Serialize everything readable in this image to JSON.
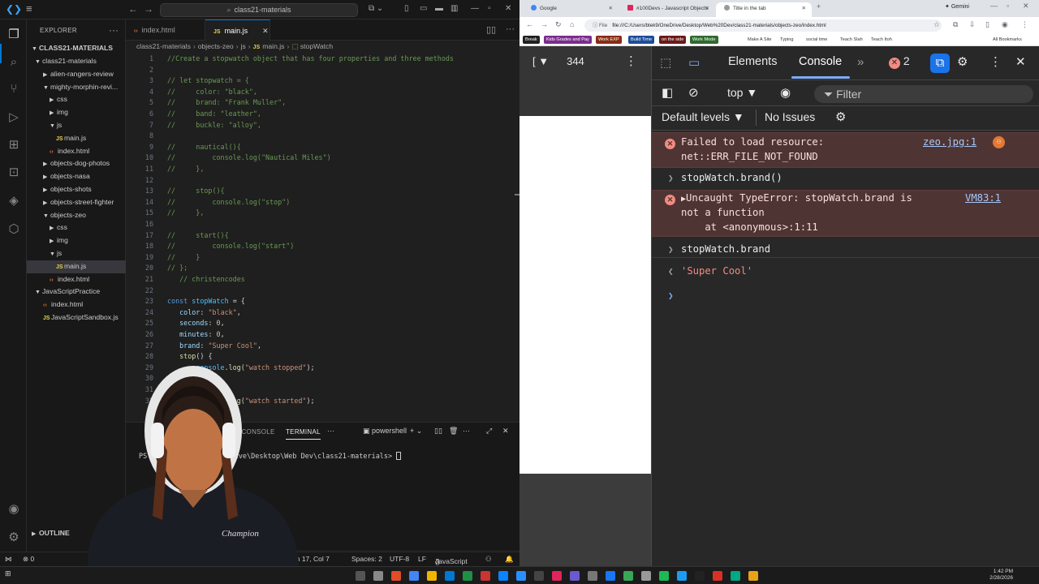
{
  "vscode": {
    "search_text": "class21-materials",
    "explorer_title": "EXPLORER",
    "project_root": "CLASS21-MATERIALS",
    "tree": [
      {
        "label": "class21-materials",
        "type": "folder-open",
        "depth": 1
      },
      {
        "label": "alien-rangers-review",
        "type": "folder",
        "depth": 2
      },
      {
        "label": "mighty-morphin-revi...",
        "type": "folder-open",
        "depth": 2
      },
      {
        "label": "css",
        "type": "folder",
        "depth": 3
      },
      {
        "label": "img",
        "type": "folder",
        "depth": 3
      },
      {
        "label": "js",
        "type": "folder-open",
        "depth": 3
      },
      {
        "label": "main.js",
        "type": "js",
        "depth": 4
      },
      {
        "label": "index.html",
        "type": "html",
        "depth": 3
      },
      {
        "label": "objects-dog-photos",
        "type": "folder",
        "depth": 2
      },
      {
        "label": "objects-nasa",
        "type": "folder",
        "depth": 2
      },
      {
        "label": "objects-shots",
        "type": "folder",
        "depth": 2
      },
      {
        "label": "objects-street-fighter",
        "type": "folder",
        "depth": 2
      },
      {
        "label": "objects-zeo",
        "type": "folder-open",
        "depth": 2
      },
      {
        "label": "css",
        "type": "folder",
        "depth": 3
      },
      {
        "label": "img",
        "type": "folder",
        "depth": 3
      },
      {
        "label": "js",
        "type": "folder-open",
        "depth": 3
      },
      {
        "label": "main.js",
        "type": "js",
        "depth": 4,
        "selected": true
      },
      {
        "label": "index.html",
        "type": "html",
        "depth": 3
      },
      {
        "label": "JavaScriptPractice",
        "type": "folder-open",
        "depth": 1
      },
      {
        "label": "index.html",
        "type": "html",
        "depth": 2
      },
      {
        "label": "JavaScriptSandbox.js",
        "type": "js",
        "depth": 2
      }
    ],
    "tabs": [
      {
        "label": "index.html",
        "type": "html"
      },
      {
        "label": "main.js",
        "type": "js",
        "active": true
      }
    ],
    "breadcrumbs": [
      "class21-materials",
      "objects-zeo",
      "js",
      "main.js",
      "stopWatch"
    ],
    "code_lines": [
      "//Create a stopwatch object that has four properties and three methods",
      "",
      "// let stopwatch = {",
      "//     color: \"black\",",
      "//     brand: \"Frank Muller\",",
      "//     band: \"leather\",",
      "//     buckle: \"alloy\",",
      "",
      "//     nautical(){",
      "//         console.log(\"Nautical Miles\")",
      "//     },",
      "",
      "//     stop(){",
      "//         console.log(\"stop\")",
      "//     },",
      "",
      "//     start(){",
      "//         console.log(\"start\")",
      "//     }",
      "// };",
      "   // christencodes",
      "",
      "const stopWatch = {",
      "   color: \"black\",",
      "   seconds: 0,",
      "   minutes: 0,",
      "   brand: \"Super Cool\",",
      "   stop() {",
      "       console.log(\"watch stopped\");",
      "   },",
      "   start() {",
      "       console.log(\"watch started\");"
    ],
    "panel_tabs": [
      "DEBUG CONSOLE",
      "TERMINAL"
    ],
    "terminal_shell": "powershell",
    "terminal_prompt": "PS C:\\Users\\btek9\\OneDrive\\Desktop\\Web Dev\\class21-materials> ",
    "status": {
      "position": "Ln 17, Col 7",
      "spaces": "Spaces: 2",
      "encoding": "UTF-8",
      "eol": "LF",
      "language": "JavaScript",
      "outline": "OUTLINE"
    }
  },
  "browser": {
    "tabs": [
      {
        "label": "Google",
        "color": "#4285f4"
      },
      {
        "label": "#100Devs - Javascript Objects",
        "color": "#e0245e"
      },
      {
        "label": "Title in the tab",
        "color": "#888",
        "active": true
      }
    ],
    "profile": "Gemini",
    "address_scheme": "File",
    "address": "file:///C:/Users/btek9/OneDrive/Desktop/Web%20Dev/class21-materials/objects-zeo/index.html",
    "bookmarks": [
      {
        "label": "Break",
        "bg": "#222",
        "fg": "#fff"
      },
      {
        "label": "Kids Grades and Pay",
        "bg": "#7b2d8e",
        "fg": "#fff"
      },
      {
        "label": "Work EXP",
        "bg": "#8a2c14",
        "fg": "#fff"
      },
      {
        "label": "Build Time",
        "bg": "#1c4d9a",
        "fg": "#fff"
      },
      {
        "label": "on the side",
        "bg": "#6a1a1a",
        "fg": "#fff"
      },
      {
        "label": "Work Mode",
        "bg": "#2e6b2e",
        "fg": "#fff"
      },
      {
        "label": "Make A Site",
        "bg": "transparent",
        "fg": "#333"
      },
      {
        "label": "Typing",
        "bg": "transparent",
        "fg": "#333"
      },
      {
        "label": "social time",
        "bg": "transparent",
        "fg": "#333"
      },
      {
        "label": "Teach Slah",
        "bg": "transparent",
        "fg": "#333"
      },
      {
        "label": "Teach Itoh",
        "bg": "transparent",
        "fg": "#333"
      },
      {
        "label": "All Bookmarks",
        "bg": "transparent",
        "fg": "#333"
      }
    ],
    "page_size_readout": "344",
    "devtools": {
      "tabs": [
        "Elements",
        "Console"
      ],
      "error_count": "2",
      "context": "top",
      "filter_placeholder": "Filter",
      "levels": "Default levels",
      "issues": "No Issues",
      "messages": [
        {
          "kind": "error",
          "line1": "Failed to load resource:",
          "line2": "net::ERR_FILE_NOT_FOUND",
          "source": "zeo.jpg:1"
        },
        {
          "kind": "input",
          "text": "stopWatch.brand()"
        },
        {
          "kind": "error",
          "line1": "Uncaught TypeError: stopWatch.brand is",
          "line2": "not a function",
          "line3": "    at <anonymous>:1:11",
          "source": "VM83:1"
        },
        {
          "kind": "input",
          "text": "stopWatch.brand"
        },
        {
          "kind": "result",
          "text": "'Super Cool'"
        }
      ]
    }
  },
  "taskbar": {
    "time": "1:42 PM",
    "date": "2/28/2026"
  }
}
